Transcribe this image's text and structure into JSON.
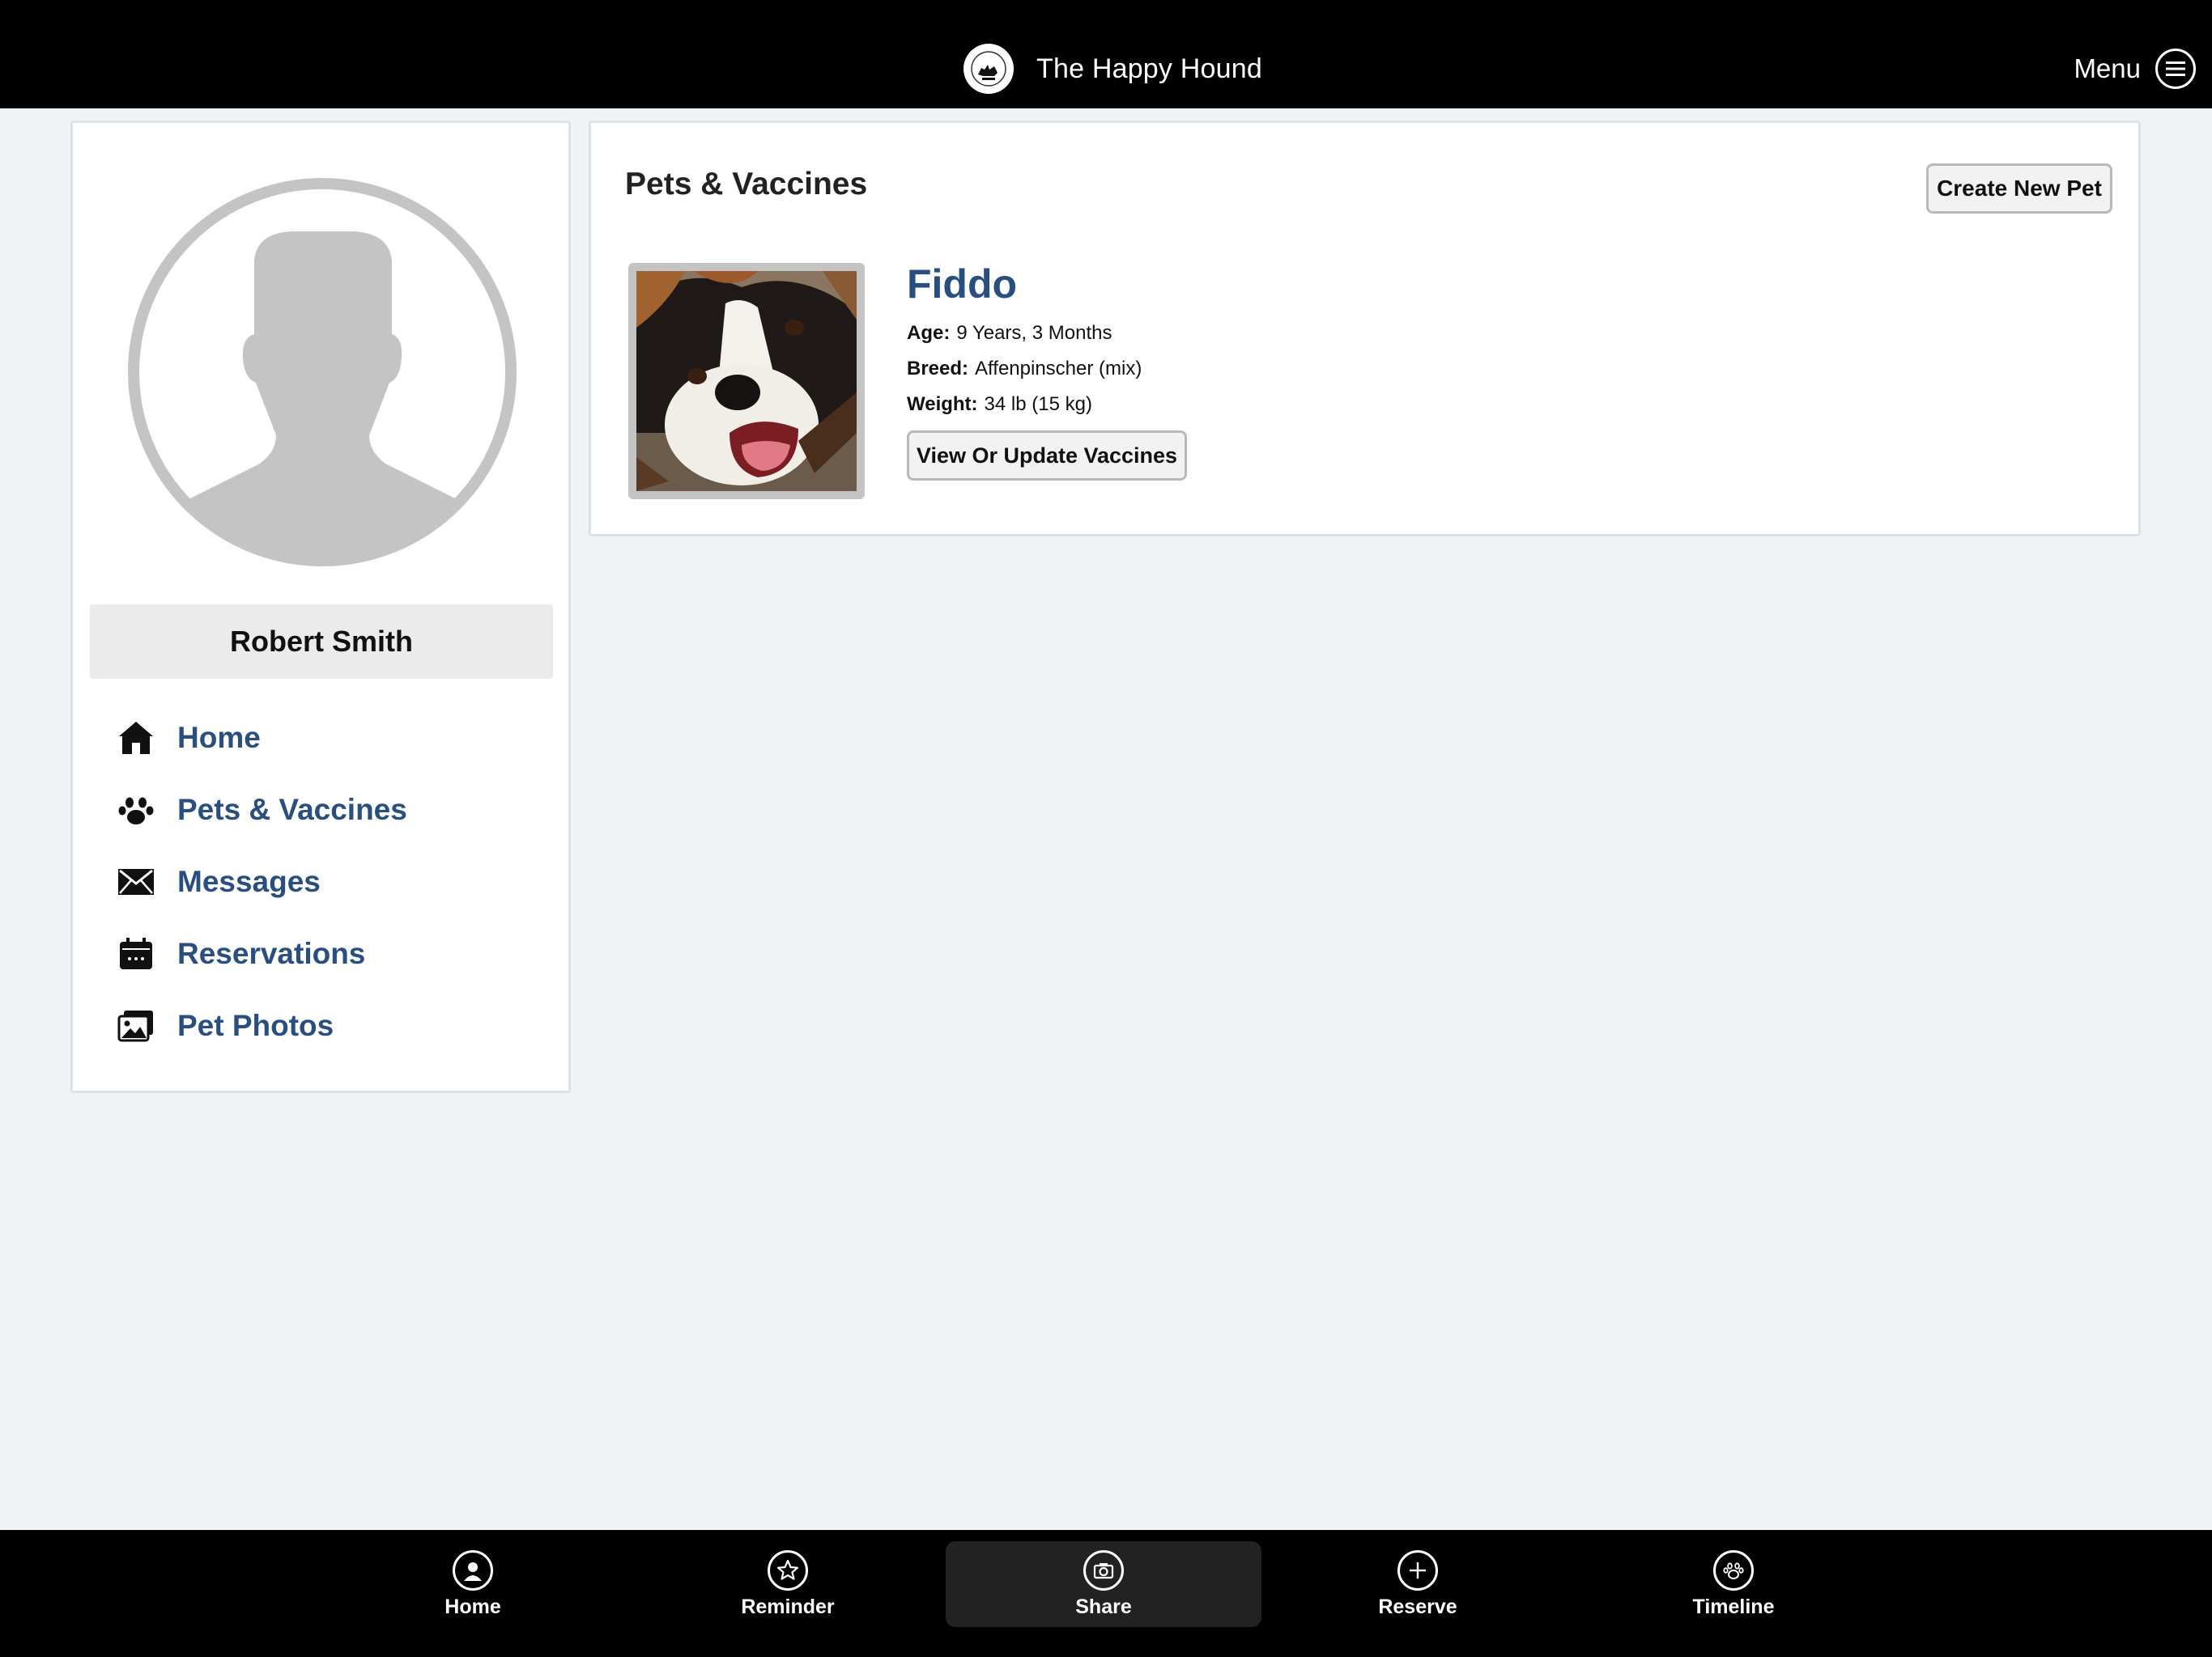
{
  "header": {
    "title": "The Happy Hound",
    "menu_label": "Menu"
  },
  "profile": {
    "name": "Robert Smith"
  },
  "sidebar": {
    "items": [
      {
        "label": "Home",
        "icon": "home-icon"
      },
      {
        "label": "Pets & Vaccines",
        "icon": "paw-icon"
      },
      {
        "label": "Messages",
        "icon": "envelope-icon"
      },
      {
        "label": "Reservations",
        "icon": "calendar-icon"
      },
      {
        "label": "Pet Photos",
        "icon": "photos-icon"
      }
    ]
  },
  "main": {
    "title": "Pets & Vaccines",
    "create_button": "Create New Pet",
    "pet": {
      "name": "Fiddo",
      "age_label": "Age:",
      "age": "9 Years, 3 Months",
      "breed_label": "Breed:",
      "breed": "Affenpinscher (mix)",
      "weight_label": "Weight:",
      "weight": "34 lb (15 kg)",
      "vaccines_button": "View Or Update Vaccines"
    }
  },
  "bottom_nav": {
    "tabs": [
      {
        "label": "Home",
        "icon": "user-circle-icon"
      },
      {
        "label": "Reminder",
        "icon": "star-icon"
      },
      {
        "label": "Share",
        "icon": "camera-icon"
      },
      {
        "label": "Reserve",
        "icon": "plus-circle-icon"
      },
      {
        "label": "Timeline",
        "icon": "paw-circle-icon"
      }
    ],
    "active": "Share"
  },
  "colors": {
    "link": "#2a4f7f",
    "topbar": "#000000",
    "page_bg": "#eff3f6"
  }
}
